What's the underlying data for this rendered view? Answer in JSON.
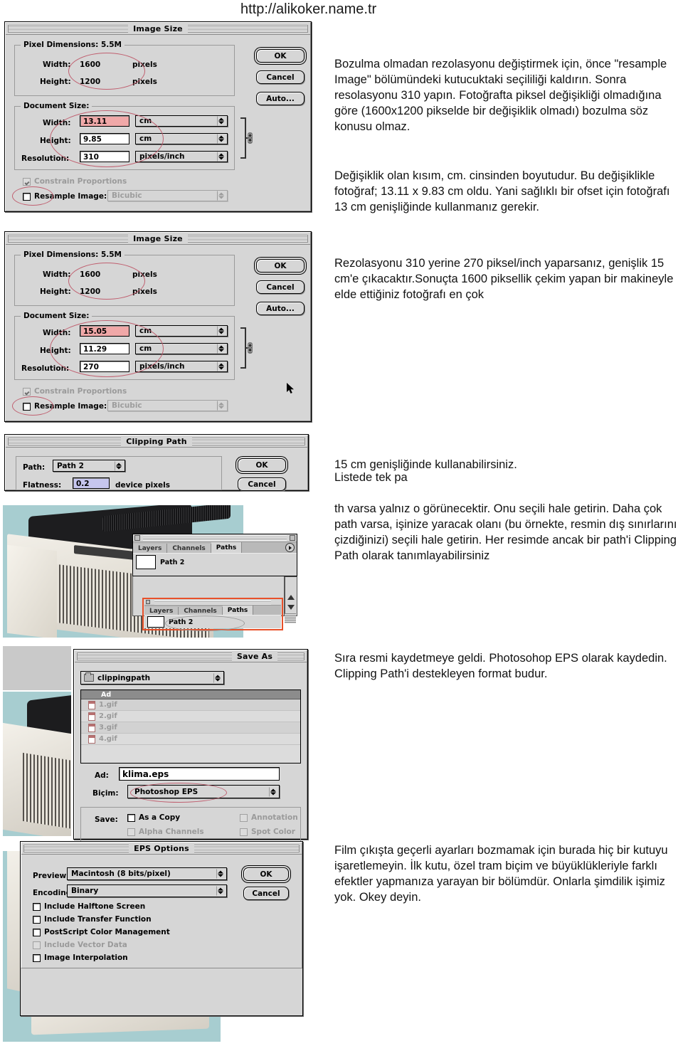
{
  "header": {
    "url": "http://alikoker.name.tr"
  },
  "image_size_dialog_1": {
    "title": "Image Size",
    "pixel_dimensions": {
      "legend": "Pixel Dimensions:  5.5M",
      "width_label": "Width:",
      "width_value": "1600",
      "width_unit": "pixels",
      "height_label": "Height:",
      "height_value": "1200",
      "height_unit": "pixels"
    },
    "document_size": {
      "legend": "Document Size:",
      "width_label": "Width:",
      "width_value": "13.11",
      "width_unit": "cm",
      "height_label": "Height:",
      "height_value": "9.85",
      "height_unit": "cm",
      "resolution_label": "Resolution:",
      "resolution_value": "310",
      "resolution_unit": "pixels/inch"
    },
    "constrain_proportions": "Constrain Proportions",
    "resample_image": "Resample Image:",
    "resample_method": "Bicubic",
    "buttons": {
      "ok": "OK",
      "cancel": "Cancel",
      "auto": "Auto..."
    }
  },
  "image_size_dialog_2": {
    "title": "Image Size",
    "pixel_dimensions": {
      "legend": "Pixel Dimensions:  5.5M",
      "width_label": "Width:",
      "width_value": "1600",
      "width_unit": "pixels",
      "height_label": "Height:",
      "height_value": "1200",
      "height_unit": "pixels"
    },
    "document_size": {
      "legend": "Document Size:",
      "width_label": "Width:",
      "width_value": "15.05",
      "width_unit": "cm",
      "height_label": "Height:",
      "height_value": "11.29",
      "height_unit": "cm",
      "resolution_label": "Resolution:",
      "resolution_value": "270",
      "resolution_unit": "pixels/inch"
    },
    "constrain_proportions": "Constrain Proportions",
    "resample_image": "Resample Image:",
    "resample_method": "Bicubic",
    "buttons": {
      "ok": "OK",
      "cancel": "Cancel",
      "auto": "Auto..."
    }
  },
  "clipping_path_dialog": {
    "title": "Clipping Path",
    "path_label": "Path:",
    "path_value": "Path 2",
    "flatness_label": "Flatness:",
    "flatness_value": "0.2",
    "flatness_unit": "device pixels",
    "buttons": {
      "ok": "OK",
      "cancel": "Cancel"
    }
  },
  "paths_palette_top": {
    "tabs": [
      "Layers",
      "Channels",
      "Paths"
    ],
    "active_tab": "Paths",
    "path_name": "Path 2"
  },
  "paths_palette_bottom": {
    "tabs": [
      "Layers",
      "Channels",
      "Paths"
    ],
    "active_tab": "Paths",
    "path_name": "Path 2"
  },
  "save_as_dialog": {
    "title": "Save As",
    "location": "clippingpath",
    "column_header": "Ad",
    "files": [
      "1.gif",
      "2.gif",
      "3.gif",
      "4.gif"
    ],
    "name_label": "Ad:",
    "name_value": "klima.eps",
    "format_label": "Biçim:",
    "format_value": "Photoshop EPS",
    "save_label": "Save:",
    "options_left": [
      "As a Copy",
      "Alpha Channels"
    ],
    "options_right": [
      "Annotation",
      "Spot Color"
    ]
  },
  "eps_options_dialog": {
    "title": "EPS Options",
    "preview_label": "Preview:",
    "preview_value": "Macintosh  (8 bits/pixel)",
    "encoding_label": "Encoding:",
    "encoding_value": "Binary",
    "checkboxes": [
      {
        "label": "Include Halftone Screen",
        "checked": false,
        "disabled": false
      },
      {
        "label": "Include Transfer Function",
        "checked": false,
        "disabled": false
      },
      {
        "label": "PostScript Color Management",
        "checked": false,
        "disabled": false
      },
      {
        "label": "Include Vector Data",
        "checked": false,
        "disabled": true
      },
      {
        "label": "Image Interpolation",
        "checked": false,
        "disabled": false
      }
    ],
    "buttons": {
      "ok": "OK",
      "cancel": "Cancel"
    }
  },
  "text": {
    "para1": "Bozulma olmadan rezolasyonu değiştirmek için, önce \"resample Image\" bölümündeki kutucuktaki seçililiği kaldırın. Sonra resolasyonu 310 yapın. Fotoğrafta piksel değişikliği olmadığına göre (1600x1200 pikselde bir değişiklik olmadı) bozulma söz konusu olmaz.",
    "para2": "Değişiklik olan kısım, cm. cinsinden boyutudur. Bu değişiklikle fotoğraf; 13.11 x 9.83 cm oldu. Yani sağlıklı bir ofset için fotoğrafı 13 cm genişliğinde kullanmanız gerekir.",
    "para3": "Rezolasyonu 310 yerine 270 piksel/inch yaparsanız, genişlik 15 cm'e çıkacaktır.Sonuçta 1600 piksellik çekim yapan bir makineyle elde ettiğiniz fotoğrafı en çok",
    "para4": "15 cm genişliğinde kullanabilirsiniz.",
    "para5": "Listede tek pa",
    "para6": "th varsa yalnız o görünecektir. Onu seçili hale getirin. Daha çok path varsa, işinize yaracak olanı (bu örnekte, resmin dış sınırlarını çizdiğinizi) seçili hale getirin. Her resimde ancak bir path'i Clipping Path olarak tanımlayabilirsiniz",
    "para7": "Sıra resmi kaydetmeye geldi. Photosohop EPS olarak kaydedin. Clipping Path'i destekleyen format budur.",
    "para8": "Film çıkışta geçerli ayarları bozmamak için burada hiç bir kutuyu işaretlemeyin. İlk kutu, özel tram biçim ve büyüklükleriyle farklı efektler yapmanıza yarayan bir bölümdür. Onlarla şimdilik işimiz yok. Okey deyin."
  },
  "colors": {
    "dialog_bg": "#d6d6d6",
    "highlight_field": "#f0a8a8",
    "annotation_red": "#c06070",
    "redbox": "#e8502a",
    "photo_bg": "#a7cdd0"
  }
}
